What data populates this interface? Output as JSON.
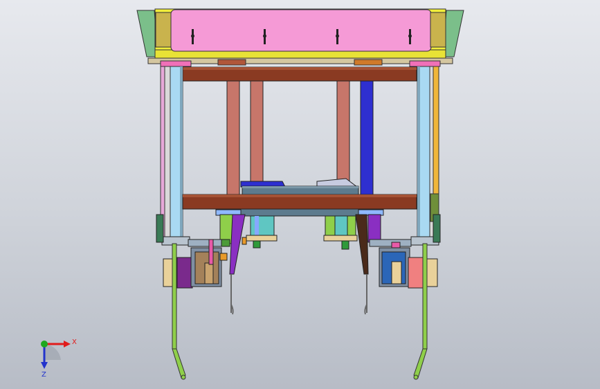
{
  "viewport": {
    "background_top": "#e7e9ee",
    "background_bottom": "#b7bcc6"
  },
  "triad": {
    "x_label": "X",
    "z_label": "Z",
    "x_color": "#e11b1b",
    "y_color": "#1fa81f",
    "z_color": "#2233cc"
  },
  "colors": {
    "top_plate": "#f59ad6",
    "yellow_frame": "#f2ee3a",
    "green_side": "#7bbf8a",
    "brown_beam": "#8a3a22",
    "post_salmon": "#c7766a",
    "post_blue": "#2e2fd0",
    "rail_lightblue": "#a9d9f2",
    "rail_orange": "#f0b63a",
    "green_finger": "#8fcf4a",
    "grey_block": "#7f8fa3",
    "cylinder_teal": "#5fc6c2",
    "tan_bracket": "#e9d19a"
  }
}
